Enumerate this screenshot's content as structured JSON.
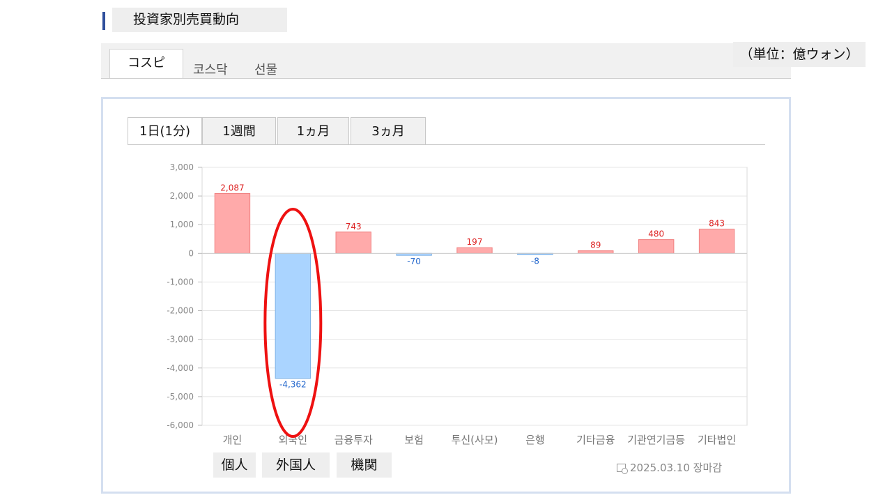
{
  "header": {
    "title": "投資家別売買動向"
  },
  "market_tabs": [
    {
      "label": "コスピ",
      "active": true
    },
    {
      "label": "코스닥",
      "active": false
    },
    {
      "label": "선물",
      "active": false
    }
  ],
  "unit_label": "（単位：億ウォン）",
  "period_tabs": [
    {
      "label": "1日(1分)",
      "active": true
    },
    {
      "label": "1週間",
      "active": false
    },
    {
      "label": "1ヵ月",
      "active": false
    },
    {
      "label": "3ヵ月",
      "active": false
    }
  ],
  "chart_data": {
    "type": "bar",
    "categories": [
      "개인",
      "외국인",
      "금융투자",
      "보험",
      "투신(사모)",
      "은행",
      "기타금융",
      "기관연기금등",
      "기타법인"
    ],
    "values": [
      2087,
      -4362,
      743,
      -70,
      197,
      -8,
      89,
      480,
      843
    ],
    "data_labels": [
      "2,087",
      "-4,362",
      "743",
      "-70",
      "197",
      "-8",
      "89",
      "480",
      "843"
    ],
    "ylim": [
      -6000,
      3000
    ],
    "yticks": [
      3000,
      2000,
      1000,
      0,
      -1000,
      -2000,
      -3000,
      -4000,
      -5000,
      -6000
    ],
    "ytick_labels": [
      "3,000",
      "2,000",
      "1,000",
      "0",
      "-1,000",
      "-2,000",
      "-3,000",
      "-4,000",
      "-5,000",
      "-6,000"
    ],
    "grid": true,
    "positive_color": "#ffaaaa",
    "positive_stroke": "#f08080",
    "negative_color": "#aad4ff",
    "negative_stroke": "#7fb2e6",
    "positive_label_color": "#dd2222",
    "negative_label_color": "#2266cc",
    "highlight_color": "#ee1111"
  },
  "annotations": {
    "group_labels": [
      "個人",
      "外国人",
      "機関"
    ]
  },
  "footer": {
    "date": "2025.03.10 장마감"
  }
}
